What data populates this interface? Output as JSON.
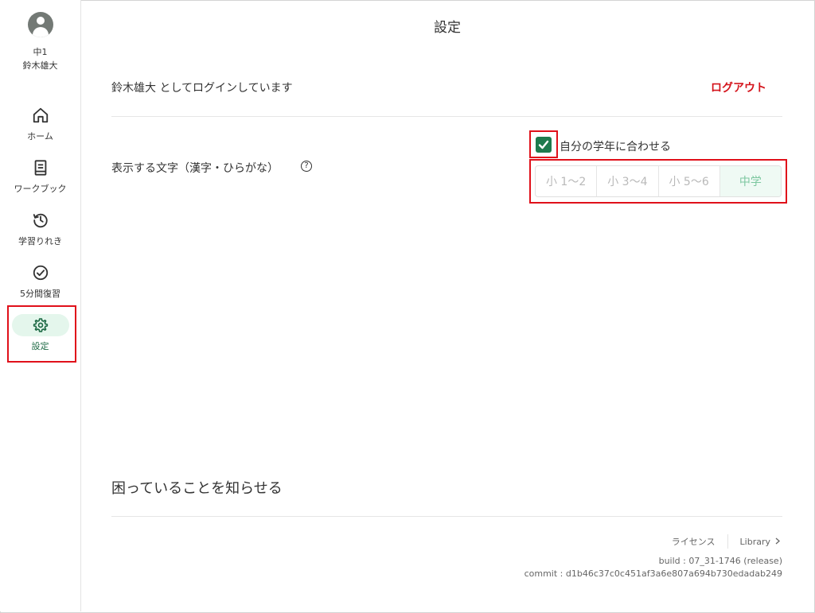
{
  "user": {
    "grade": "中1",
    "name": "鈴木雄大"
  },
  "sidebar": {
    "items": [
      {
        "label": "ホーム",
        "icon": "home-icon"
      },
      {
        "label": "ワークブック",
        "icon": "book-icon"
      },
      {
        "label": "学習りれき",
        "icon": "history-icon"
      },
      {
        "label": "5分間復習",
        "icon": "check-circle-icon"
      },
      {
        "label": "設定",
        "icon": "gear-icon",
        "active": true
      }
    ]
  },
  "header": {
    "title": "設定"
  },
  "account": {
    "login_text": "鈴木雄大 としてログインしています",
    "logout_label": "ログアウト"
  },
  "display_chars": {
    "label": "表示する文字（漢字・ひらがな）",
    "help_icon": "?",
    "match_grade": {
      "label": "自分の学年に合わせる",
      "checked": true
    },
    "options": [
      "小 1〜2",
      "小 3〜4",
      "小 5〜6",
      "中学"
    ],
    "selected": "中学"
  },
  "report": {
    "label": "困っていることを知らせる"
  },
  "footer": {
    "license_label": "ライセンス",
    "library_label": "Library",
    "build": "build : 07_31-1746 (release)",
    "commit": "commit : d1b46c37c0c451af3a6e807a694b730edadab249"
  },
  "colors": {
    "accent_green": "#1e7a4d",
    "logout_red": "#d4131b",
    "active_pill": "#e4f6ec",
    "highlight": "#e0101a"
  }
}
